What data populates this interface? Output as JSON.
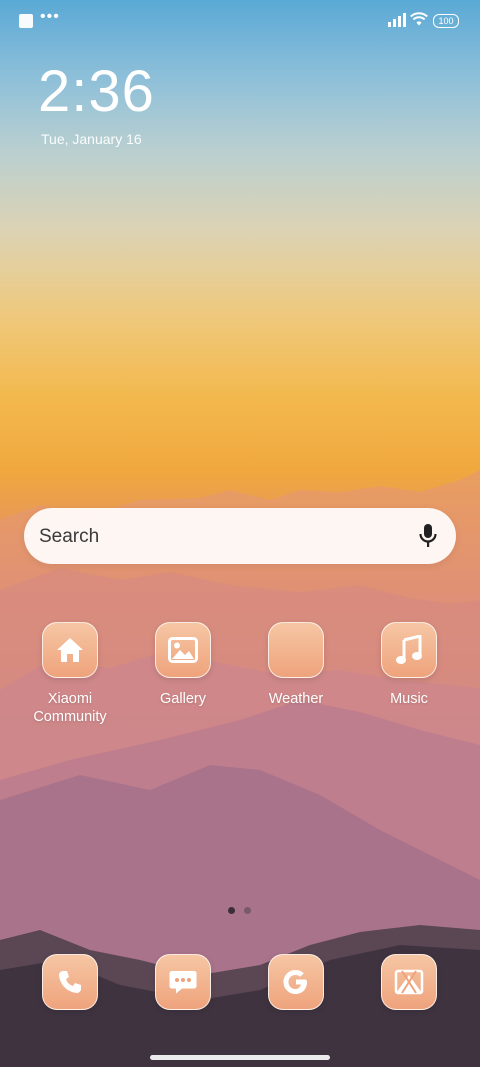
{
  "status_bar": {
    "battery": "100",
    "icons": [
      "notification-square-icon",
      "more-dots-icon",
      "signal-icon",
      "wifi-icon",
      "battery-icon"
    ]
  },
  "lock": {
    "time": "2:36",
    "date": "Tue, January 16"
  },
  "search": {
    "placeholder": "Search",
    "icon": "mic-icon"
  },
  "apps": [
    {
      "label": "Xiaomi\nCommunity",
      "icon": "home-icon"
    },
    {
      "label": "Gallery",
      "icon": "gallery-icon"
    },
    {
      "label": "Weather",
      "icon": "weather-icon"
    },
    {
      "label": "Music",
      "icon": "music-icon"
    }
  ],
  "dock": [
    {
      "icon": "phone-icon"
    },
    {
      "icon": "messages-icon"
    },
    {
      "icon": "google-icon"
    },
    {
      "icon": "camera-icon"
    }
  ],
  "pager": {
    "pages": 2,
    "current": 1
  },
  "colors": {
    "icon_top": "#f6c6a4",
    "icon_bottom": "#eea37c",
    "search_bg": "#fffaf8"
  }
}
